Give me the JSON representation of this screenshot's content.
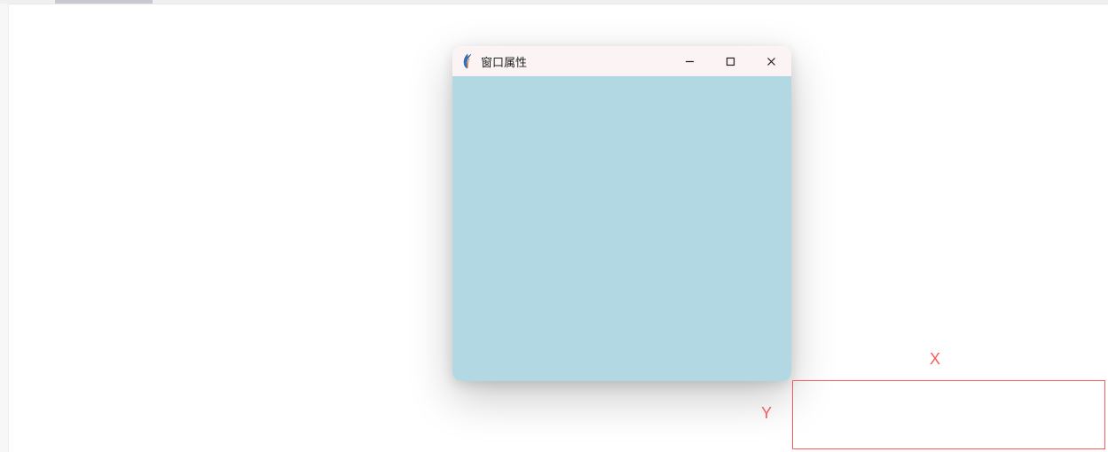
{
  "window": {
    "title": "窗口属性",
    "icon": "tk-feather-icon",
    "content_bg": "#b1d8e3",
    "titlebar_bg": "#fbf3f4",
    "controls": {
      "minimize": "minimize-icon",
      "maximize": "maximize-icon",
      "close": "close-icon"
    }
  },
  "diagram": {
    "x_label": "X",
    "y_label": "Y",
    "border_color": "#fb5a56"
  }
}
